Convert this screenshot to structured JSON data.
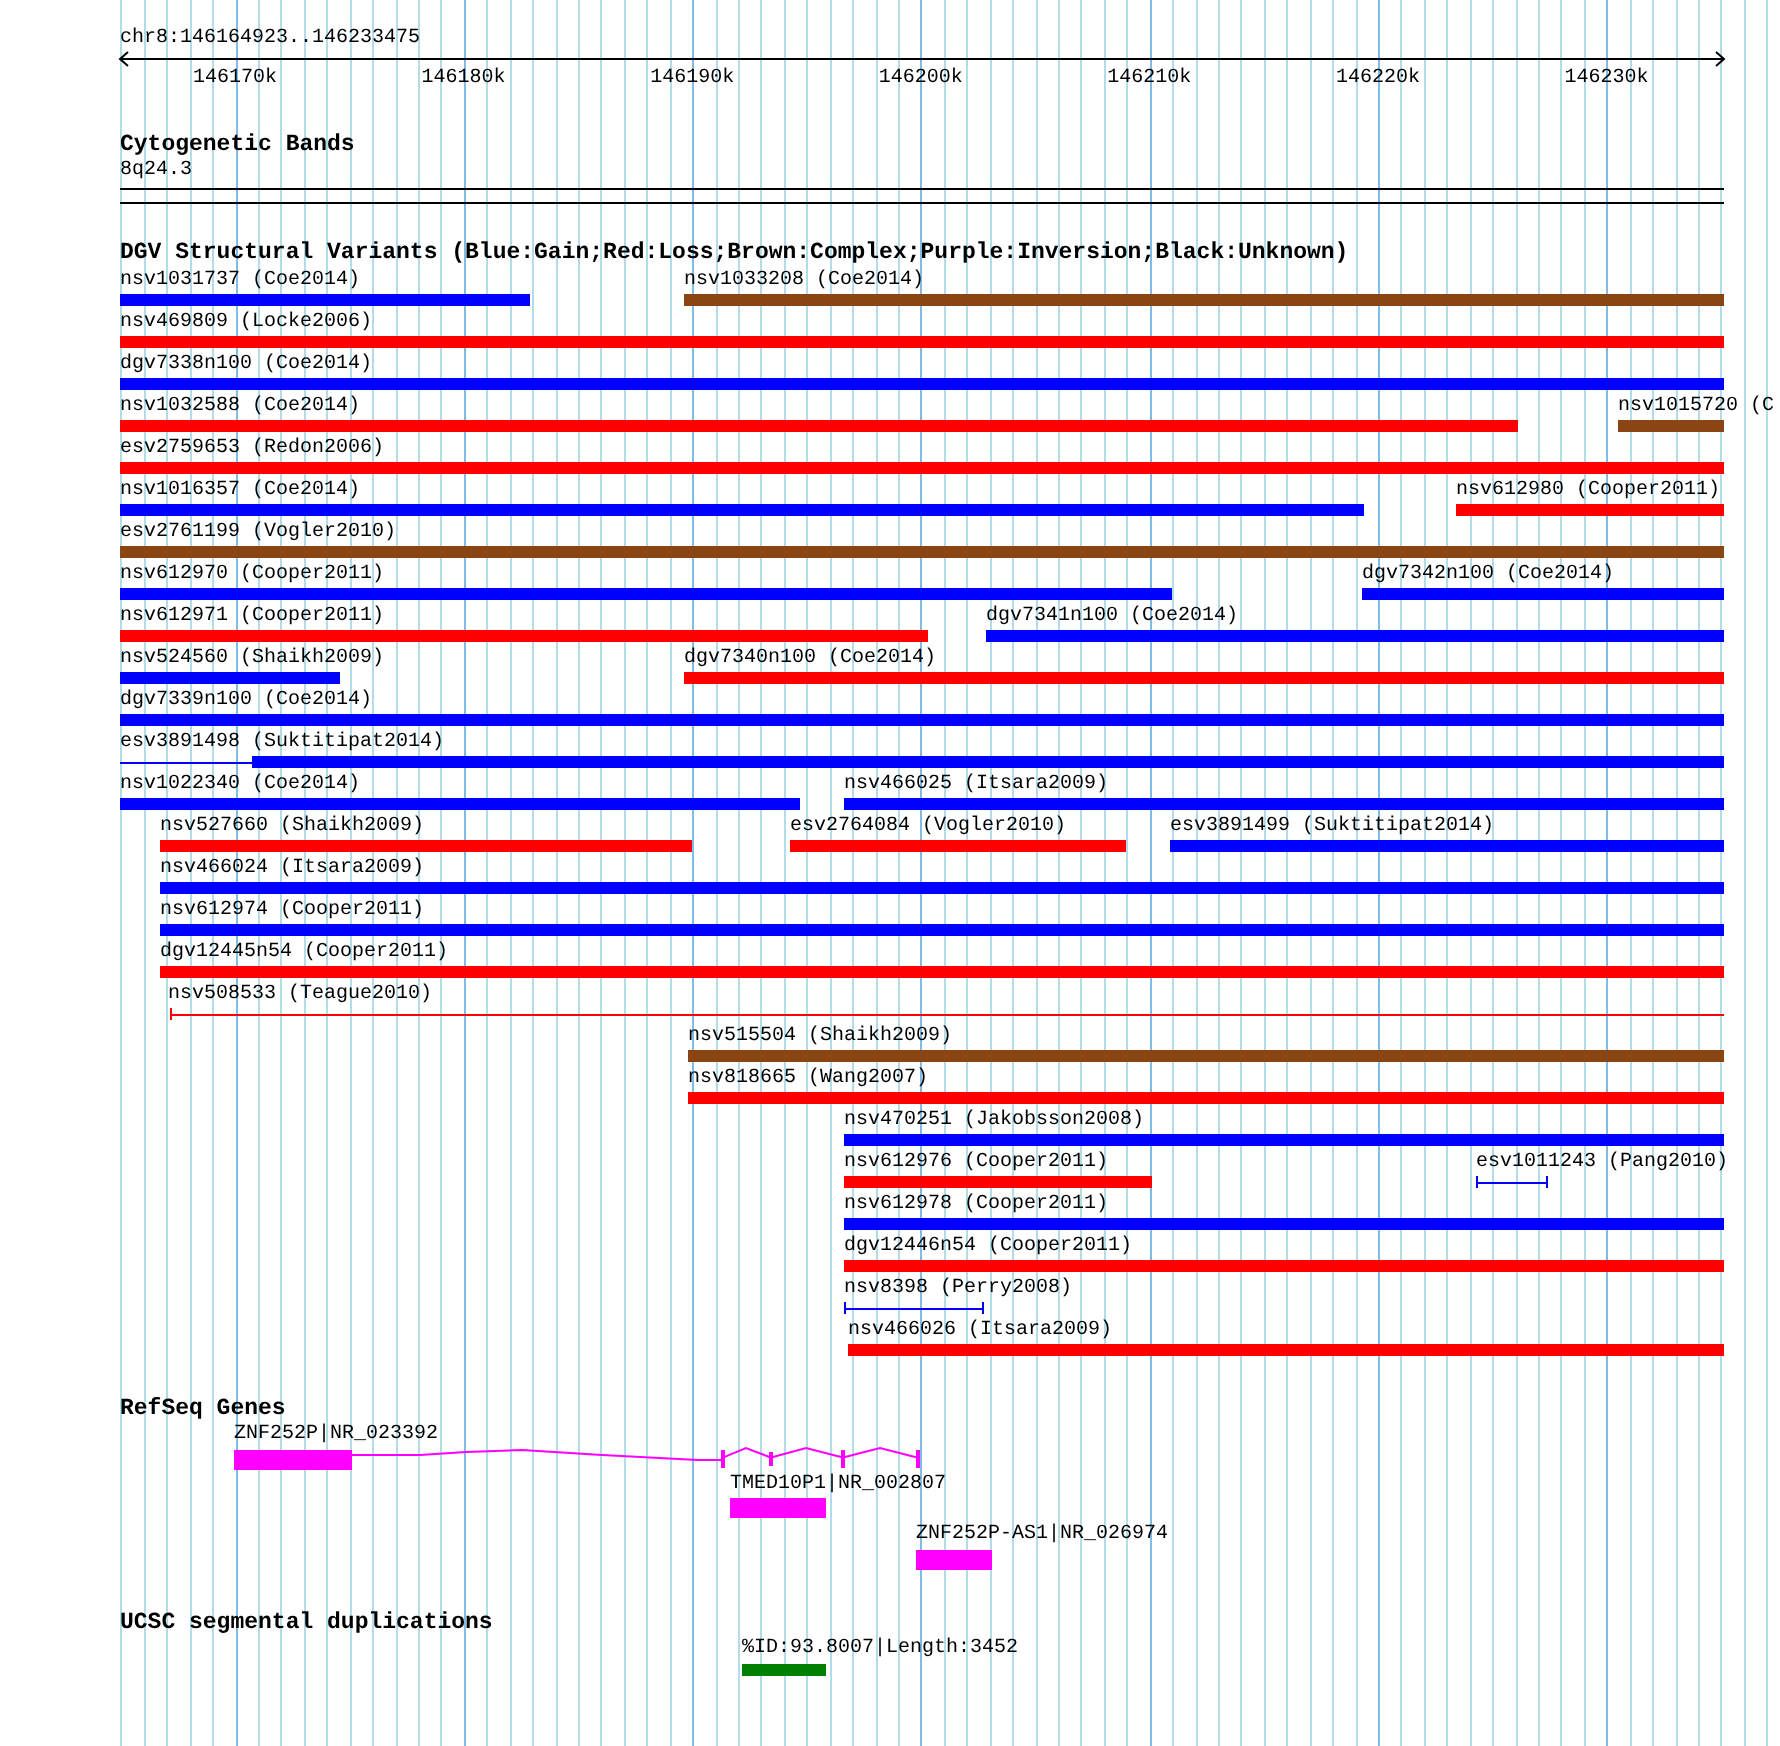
{
  "ruler": {
    "location": "chr8:146164923..146233475",
    "ticks": [
      "146170k",
      "146180k",
      "146190k",
      "146200k",
      "146210k",
      "146220k",
      "146230k"
    ]
  },
  "tracks": [
    {
      "kind": "cytoband",
      "title": "Cytogenetic Bands",
      "features": [
        {
          "label": "8q24.3"
        }
      ]
    },
    {
      "kind": "variants",
      "title": "DGV Structural Variants (Blue:Gain;Red:Loss;Brown:Complex;Purple:Inversion;Black:Unknown)",
      "rows": [
        {
          "features": [
            {
              "label": "nsv1031737 (Coe2014)",
              "color": "#0000ff",
              "kind": "bar"
            },
            {
              "label": "nsv1033208 (Coe2014)",
              "color": "#8b4513",
              "kind": "bar"
            }
          ]
        },
        {
          "features": [
            {
              "label": "nsv469809 (Locke2006)",
              "color": "#ff0000",
              "kind": "bar"
            }
          ]
        },
        {
          "features": [
            {
              "label": "dgv7338n100 (Coe2014)",
              "color": "#0000ff",
              "kind": "bar"
            }
          ]
        },
        {
          "features": [
            {
              "label": "nsv1032588 (Coe2014)",
              "color": "#ff0000",
              "kind": "bar"
            },
            {
              "label": "nsv1015720 (C",
              "color": "#8b4513",
              "kind": "bar"
            }
          ]
        },
        {
          "features": [
            {
              "label": "esv2759653 (Redon2006)",
              "color": "#ff0000",
              "kind": "bar"
            }
          ]
        },
        {
          "features": [
            {
              "label": "nsv1016357 (Coe2014)",
              "color": "#0000ff",
              "kind": "bar"
            },
            {
              "label": "nsv612980 (Cooper2011)",
              "color": "#ff0000",
              "kind": "bar"
            }
          ]
        },
        {
          "features": [
            {
              "label": "esv2761199 (Vogler2010)",
              "color": "#8b4513",
              "kind": "bar"
            }
          ]
        },
        {
          "features": [
            {
              "label": "nsv612970 (Cooper2011)",
              "color": "#0000ff",
              "kind": "bar"
            },
            {
              "label": "dgv7342n100 (Coe2014)",
              "color": "#0000ff",
              "kind": "bar"
            }
          ]
        },
        {
          "features": [
            {
              "label": "nsv612971 (Cooper2011)",
              "color": "#ff0000",
              "kind": "bar"
            },
            {
              "label": "dgv7341n100 (Coe2014)",
              "color": "#0000ff",
              "kind": "bar"
            }
          ]
        },
        {
          "features": [
            {
              "label": "nsv524560 (Shaikh2009)",
              "color": "#0000ff",
              "kind": "bar"
            },
            {
              "label": "dgv7340n100 (Coe2014)",
              "color": "#ff0000",
              "kind": "bar"
            }
          ]
        },
        {
          "features": [
            {
              "label": "dgv7339n100 (Coe2014)",
              "color": "#0000ff",
              "kind": "bar"
            }
          ]
        },
        {
          "features": [
            {
              "label": "esv3891498 (Suktitipat2014)",
              "color": "#0000ff",
              "kind": "bar"
            }
          ]
        },
        {
          "features": [
            {
              "label": "nsv1022340 (Coe2014)",
              "color": "#0000ff",
              "kind": "bar"
            },
            {
              "label": "nsv466025 (Itsara2009)",
              "color": "#0000ff",
              "kind": "bar"
            }
          ]
        },
        {
          "features": [
            {
              "label": "nsv527660 (Shaikh2009)",
              "color": "#ff0000",
              "kind": "bar"
            },
            {
              "label": "esv2764084 (Vogler2010)",
              "color": "#ff0000",
              "kind": "bar"
            },
            {
              "label": "esv3891499 (Suktitipat2014)",
              "color": "#0000ff",
              "kind": "bar"
            }
          ]
        },
        {
          "features": [
            {
              "label": "nsv466024 (Itsara2009)",
              "color": "#0000ff",
              "kind": "bar"
            }
          ]
        },
        {
          "features": [
            {
              "label": "nsv612974 (Cooper2011)",
              "color": "#0000ff",
              "kind": "bar"
            }
          ]
        },
        {
          "features": [
            {
              "label": "dgv12445n54 (Cooper2011)",
              "color": "#ff0000",
              "kind": "bar"
            }
          ]
        },
        {
          "features": [
            {
              "label": "nsv508533 (Teague2010)",
              "color": "#ff0000",
              "kind": "span"
            }
          ]
        },
        {
          "features": [
            {
              "label": "nsv515504 (Shaikh2009)",
              "color": "#8b4513",
              "kind": "bar"
            }
          ]
        },
        {
          "features": [
            {
              "label": "nsv818665 (Wang2007)",
              "color": "#ff0000",
              "kind": "bar"
            }
          ]
        },
        {
          "features": [
            {
              "label": "nsv470251 (Jakobsson2008)",
              "color": "#0000ff",
              "kind": "bar"
            }
          ]
        },
        {
          "features": [
            {
              "label": "nsv612976 (Cooper2011)",
              "color": "#ff0000",
              "kind": "bar"
            },
            {
              "label": "esv1011243 (Pang2010)",
              "color": "#0000ff",
              "kind": "span"
            }
          ]
        },
        {
          "features": [
            {
              "label": "nsv612978 (Cooper2011)",
              "color": "#0000ff",
              "kind": "bar"
            }
          ]
        },
        {
          "features": [
            {
              "label": "dgv12446n54 (Cooper2011)",
              "color": "#ff0000",
              "kind": "bar"
            }
          ]
        },
        {
          "features": [
            {
              "label": "nsv8398 (Perry2008)",
              "color": "#0000ff",
              "kind": "span"
            }
          ]
        },
        {
          "features": [
            {
              "label": "nsv466026 (Itsara2009)",
              "color": "#ff0000",
              "kind": "bar"
            }
          ]
        }
      ]
    },
    {
      "kind": "genes",
      "title": "RefSeq Genes",
      "features": [
        {
          "label": "ZNF252P|NR_023392"
        },
        {
          "label": "TMED10P1|NR_002807"
        },
        {
          "label": "ZNF252P-AS1|NR_026974"
        }
      ]
    },
    {
      "kind": "segdups",
      "title": "UCSC segmental duplications",
      "features": [
        {
          "label": "%ID:93.8007|Length:3452"
        }
      ]
    }
  ]
}
